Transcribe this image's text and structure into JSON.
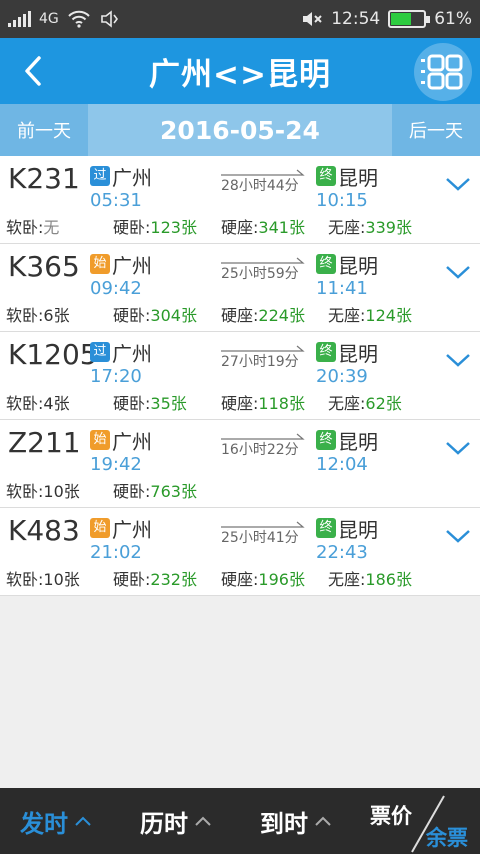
{
  "status_bar": {
    "network": "4G",
    "time": "12:54",
    "battery": "61%",
    "battery_level": 0.61
  },
  "header": {
    "title": "广州<>昆明"
  },
  "date_bar": {
    "prev": "前一天",
    "date": "2016-05-24",
    "next": "后一天"
  },
  "trains": [
    {
      "number": "K231",
      "dep_badge": "过",
      "dep_type": "pass",
      "dep_station": "广州",
      "dep_time": "05:31",
      "duration": "28小时44分",
      "arr_badge": "终",
      "arr_station": "昆明",
      "arr_time": "10:15",
      "seats": [
        {
          "label": "软卧:",
          "value": "无",
          "none": true
        },
        {
          "label": "硬卧:",
          "value": "123张"
        },
        {
          "label": "硬座:",
          "value": "341张"
        },
        {
          "label": "无座:",
          "value": "339张"
        }
      ]
    },
    {
      "number": "K365",
      "dep_badge": "始",
      "dep_type": "start",
      "dep_station": "广州",
      "dep_time": "09:42",
      "duration": "25小时59分",
      "arr_badge": "终",
      "arr_station": "昆明",
      "arr_time": "11:41",
      "seats": [
        {
          "label": "软卧:",
          "value": "6张",
          "plain": true
        },
        {
          "label": "硬卧:",
          "value": "304张"
        },
        {
          "label": "硬座:",
          "value": "224张"
        },
        {
          "label": "无座:",
          "value": "124张"
        }
      ]
    },
    {
      "number": "K1205",
      "dep_badge": "过",
      "dep_type": "pass",
      "dep_station": "广州",
      "dep_time": "17:20",
      "duration": "27小时19分",
      "arr_badge": "终",
      "arr_station": "昆明",
      "arr_time": "20:39",
      "seats": [
        {
          "label": "软卧:",
          "value": "4张",
          "plain": true
        },
        {
          "label": "硬卧:",
          "value": "35张"
        },
        {
          "label": "硬座:",
          "value": "118张"
        },
        {
          "label": "无座:",
          "value": "62张"
        }
      ]
    },
    {
      "number": "Z211",
      "dep_badge": "始",
      "dep_type": "start",
      "dep_station": "广州",
      "dep_time": "19:42",
      "duration": "16小时22分",
      "arr_badge": "终",
      "arr_station": "昆明",
      "arr_time": "12:04",
      "seats": [
        {
          "label": "软卧:",
          "value": "10张",
          "plain": true
        },
        {
          "label": "硬卧:",
          "value": "763张"
        }
      ]
    },
    {
      "number": "K483",
      "dep_badge": "始",
      "dep_type": "start",
      "dep_station": "广州",
      "dep_time": "21:02",
      "duration": "25小时41分",
      "arr_badge": "终",
      "arr_station": "昆明",
      "arr_time": "22:43",
      "seats": [
        {
          "label": "软卧:",
          "value": "10张",
          "plain": true
        },
        {
          "label": "硬卧:",
          "value": "232张"
        },
        {
          "label": "硬座:",
          "value": "196张"
        },
        {
          "label": "无座:",
          "value": "186张"
        }
      ]
    }
  ],
  "bottom_bar": {
    "depart": "发时",
    "duration": "历时",
    "arrive": "到时",
    "price": "票价",
    "remaining": "余票"
  },
  "colors": {
    "header_bg": "#1e96e0",
    "accent": "#2a8fd8",
    "available": "#2a9a2a"
  }
}
